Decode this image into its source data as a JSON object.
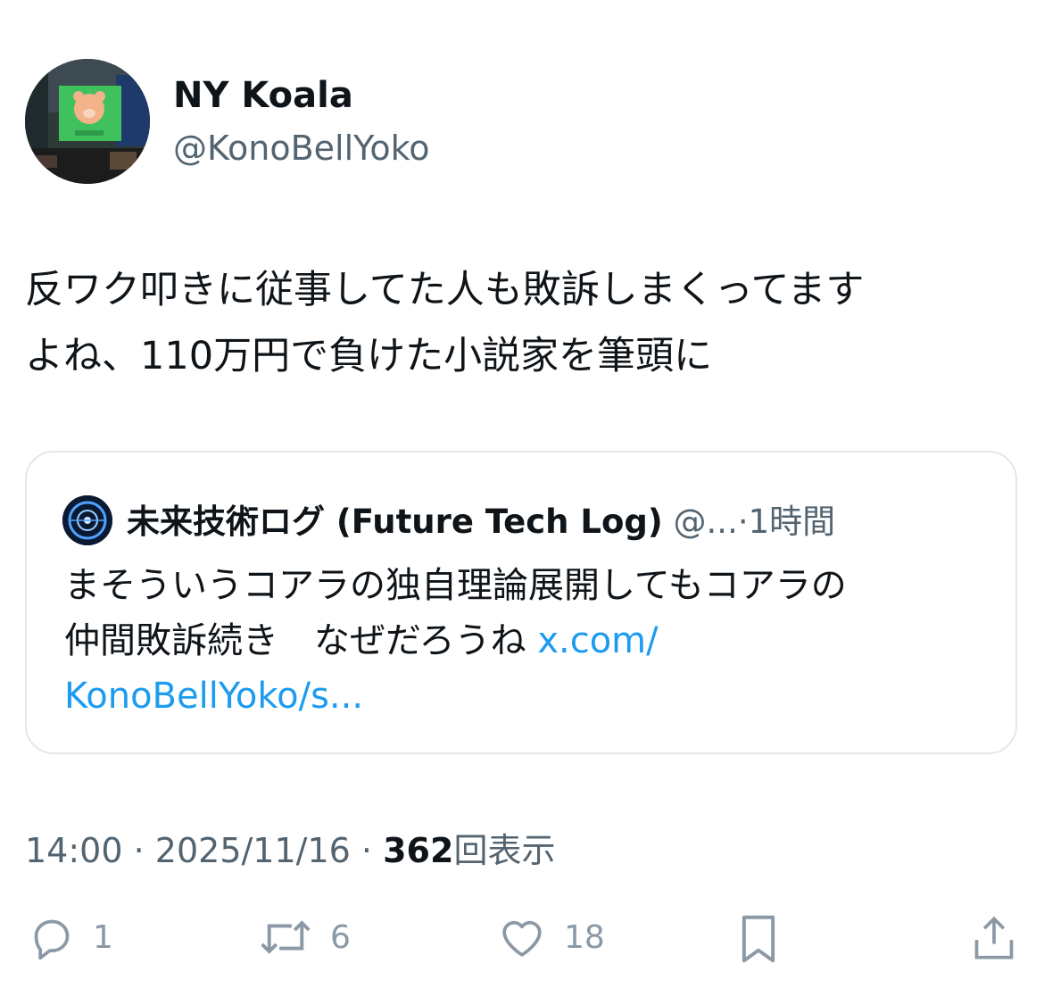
{
  "author": {
    "display_name": "NY Koala",
    "handle": "@KonoBellYoko",
    "avatar_icon": "avatar-photo-times-square"
  },
  "tweet": {
    "text_line1": "反ワク叩きに従事してた人も敗訴しまくってます",
    "text_line2": "よね、110万円で負けた小説家を筆頭に"
  },
  "quote": {
    "avatar_icon": "avatar-tech-globe",
    "display_name": "未来技術ログ (Future Tech Log)",
    "handle_truncated": "@...",
    "separator": "·",
    "time": "1時間",
    "text_line1": "まそういうコアラの独自理論展開してもコアラの",
    "text_line2": "仲間敗訴続き　なぜだろうね",
    "link_part1": "x.com/",
    "link_part2": "KonoBellYoko/s..."
  },
  "meta": {
    "time": "14:00",
    "sep1": "·",
    "date": "2025/11/16",
    "sep2": "·",
    "views_count": "362",
    "views_label": "回表示"
  },
  "actions": {
    "reply_count": "1",
    "repost_count": "6",
    "like_count": "18"
  },
  "colors": {
    "link": "#1d9bf0",
    "secondary_text": "#536471",
    "icon_gray": "#8b98a5",
    "border": "#e3e7ea"
  }
}
